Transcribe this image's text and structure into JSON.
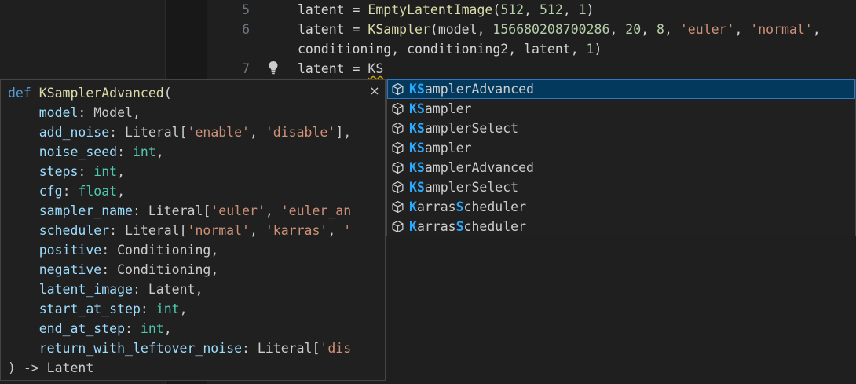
{
  "editor": {
    "line_numbers": [
      "5",
      "6",
      "",
      "7"
    ],
    "line5": {
      "var": "latent",
      "eq": " = ",
      "fn": "EmptyLatentImage",
      "open": "(",
      "a1": "512",
      "c1": ", ",
      "a2": "512",
      "c2": ", ",
      "a3": "1",
      "close": ")"
    },
    "line6": {
      "var": "latent",
      "eq": " = ",
      "fn": "KSampler",
      "open": "(",
      "p1": "model",
      "c1": ", ",
      "n1": "156680208700286",
      "c2": ", ",
      "n2": "20",
      "c3": ", ",
      "n3": "8",
      "c4": ", ",
      "s1": "'euler'",
      "c5": ", ",
      "s2": "'normal'",
      "c6": ","
    },
    "line6b": {
      "p1": "conditioning",
      "c1": ", ",
      "p2": "conditioning2",
      "c2": ", ",
      "p3": "latent",
      "c3": ", ",
      "n1": "1",
      "close": ")"
    },
    "line7": {
      "var": "latent",
      "eq": " = ",
      "typed": "KS"
    }
  },
  "signature": {
    "def_kw": "def",
    "fn_name": "KSamplerAdvanced",
    "open": "(",
    "params": [
      {
        "name": "model",
        "sep": ": ",
        "type": "Model",
        "end": ","
      },
      {
        "name": "add_noise",
        "sep": ": ",
        "type": "Literal[",
        "s1": "'enable'",
        "c": ", ",
        "s2": "'disable'",
        "end": "],"
      },
      {
        "name": "noise_seed",
        "sep": ": ",
        "type": "int",
        "end": ","
      },
      {
        "name": "steps",
        "sep": ": ",
        "type": "int",
        "end": ","
      },
      {
        "name": "cfg",
        "sep": ": ",
        "type": "float",
        "end": ","
      },
      {
        "name": "sampler_name",
        "sep": ": ",
        "type": "Literal[",
        "s1": "'euler'",
        "c": ", ",
        "s2": "'euler_an"
      },
      {
        "name": "scheduler",
        "sep": ": ",
        "type": "Literal[",
        "s1": "'normal'",
        "c": ", ",
        "s2": "'karras'",
        "c2": ", ",
        "s3": "'"
      },
      {
        "name": "positive",
        "sep": ": ",
        "type": "Conditioning",
        "end": ","
      },
      {
        "name": "negative",
        "sep": ": ",
        "type": "Conditioning",
        "end": ","
      },
      {
        "name": "latent_image",
        "sep": ": ",
        "type": "Latent",
        "end": ","
      },
      {
        "name": "start_at_step",
        "sep": ": ",
        "type": "int",
        "end": ","
      },
      {
        "name": "end_at_step",
        "sep": ": ",
        "type": "int",
        "end": ","
      },
      {
        "name": "return_with_leftover_noise",
        "sep": ": ",
        "type": "Literal[",
        "s1": "'dis"
      }
    ],
    "close": ") -> ",
    "return_type": "Latent",
    "close_icon": "×"
  },
  "suggestions": [
    {
      "match": "KS",
      "rest": "amplerAdvanced",
      "icon": "cube-icon",
      "selected": true
    },
    {
      "match": "KS",
      "rest": "ampler",
      "icon": "cube-icon"
    },
    {
      "match": "KS",
      "rest": "amplerSelect",
      "icon": "cube-icon"
    },
    {
      "match": "KS",
      "rest": "ampler",
      "icon": "cube-icon"
    },
    {
      "match": "KS",
      "rest": "amplerAdvanced",
      "icon": "cube-icon"
    },
    {
      "match": "KS",
      "rest": "amplerSelect",
      "icon": "cube-icon"
    },
    {
      "pre": "K",
      "mid": "arras",
      "match2": "S",
      "rest": "cheduler",
      "icon": "cube-icon"
    },
    {
      "pre": "K",
      "mid": "arras",
      "match2": "S",
      "rest": "cheduler",
      "icon": "cube-icon"
    }
  ],
  "colors": {
    "background": "#1f1f1f",
    "popup_bg": "#202020",
    "selected_bg": "#04395e",
    "highlight": "#2aaaff",
    "keyword": "#569cd6",
    "function": "#dcdcaa",
    "string": "#ce9178",
    "number": "#b5cea8",
    "type": "#4ec9b0",
    "variable": "#9cdcfe"
  }
}
